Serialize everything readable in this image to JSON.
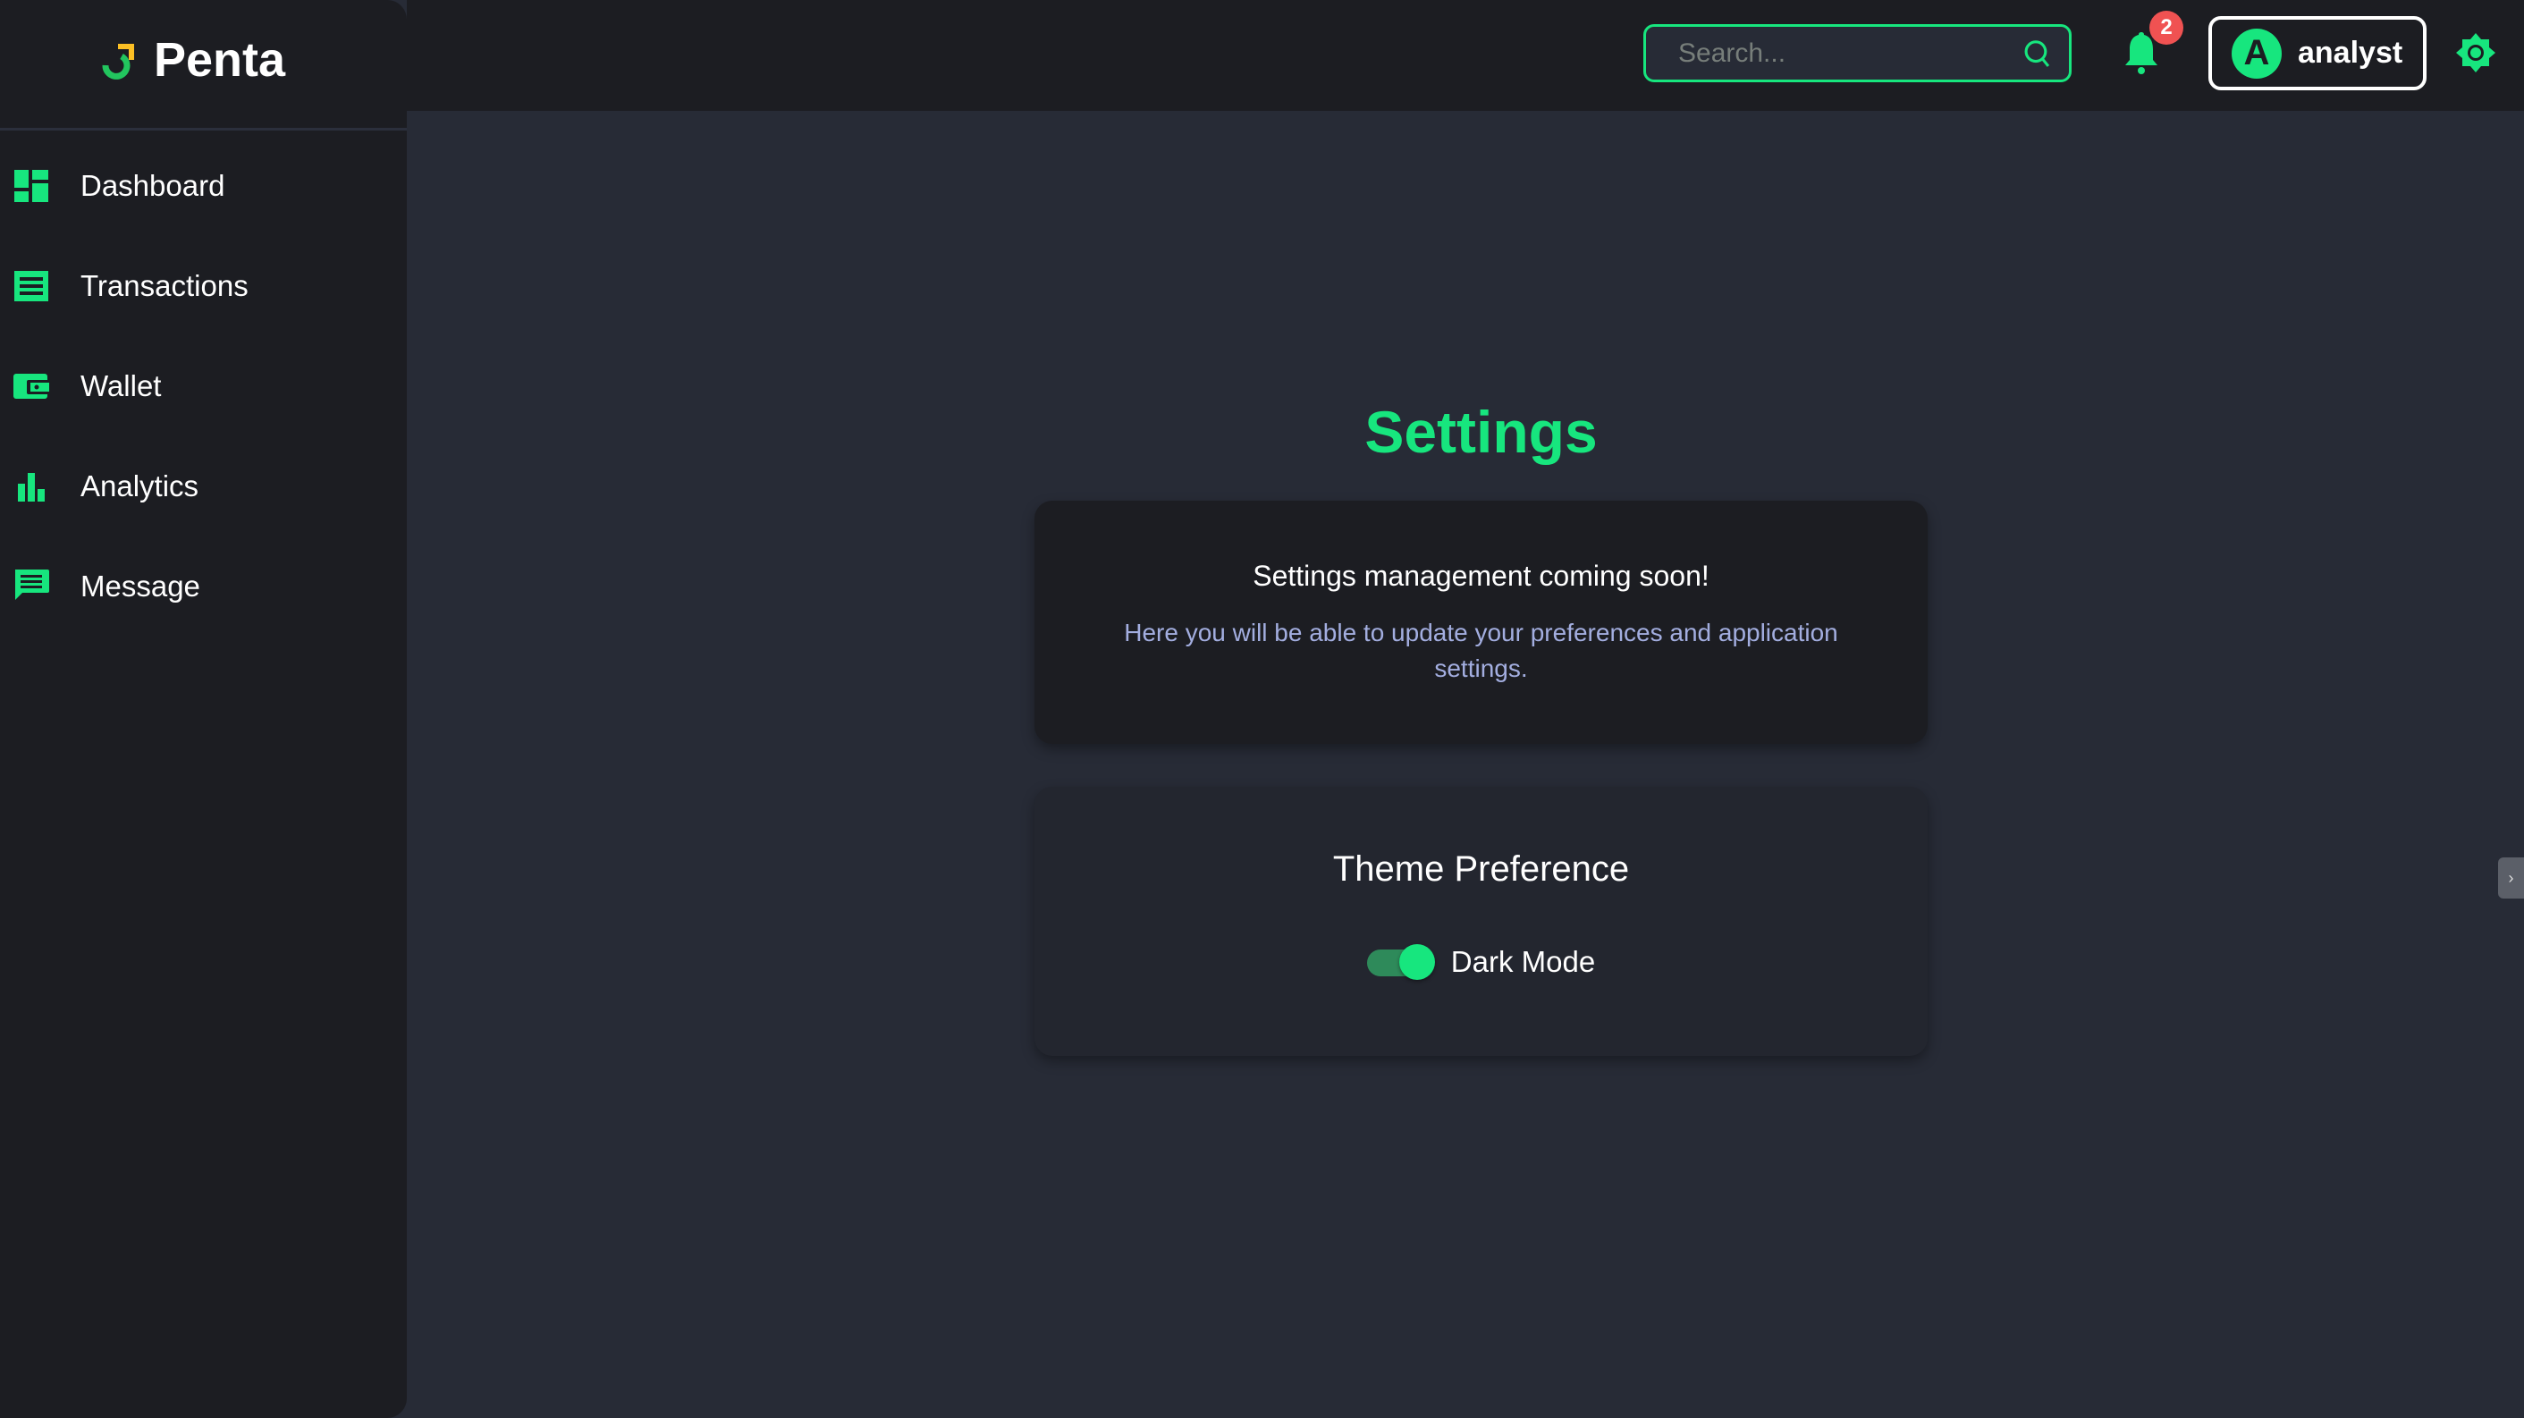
{
  "brand": {
    "name": "Penta",
    "accent": "#17e67e",
    "logo_secondary": "#fbbf24"
  },
  "sidebar": {
    "items": [
      {
        "label": "Dashboard",
        "icon": "dashboard-icon"
      },
      {
        "label": "Transactions",
        "icon": "receipt-icon"
      },
      {
        "label": "Wallet",
        "icon": "wallet-icon"
      },
      {
        "label": "Analytics",
        "icon": "bar-chart-icon"
      },
      {
        "label": "Message",
        "icon": "message-icon"
      }
    ]
  },
  "header": {
    "search_placeholder": "Search...",
    "notification_count": "2",
    "user_initial": "A",
    "user_name": "analyst"
  },
  "main": {
    "title": "Settings",
    "info_card": {
      "heading": "Settings management coming soon!",
      "text": "Here you will be able to update your preferences and application settings."
    },
    "theme_card": {
      "heading": "Theme Preference",
      "toggle_label": "Dark Mode",
      "toggle_on": true
    }
  }
}
